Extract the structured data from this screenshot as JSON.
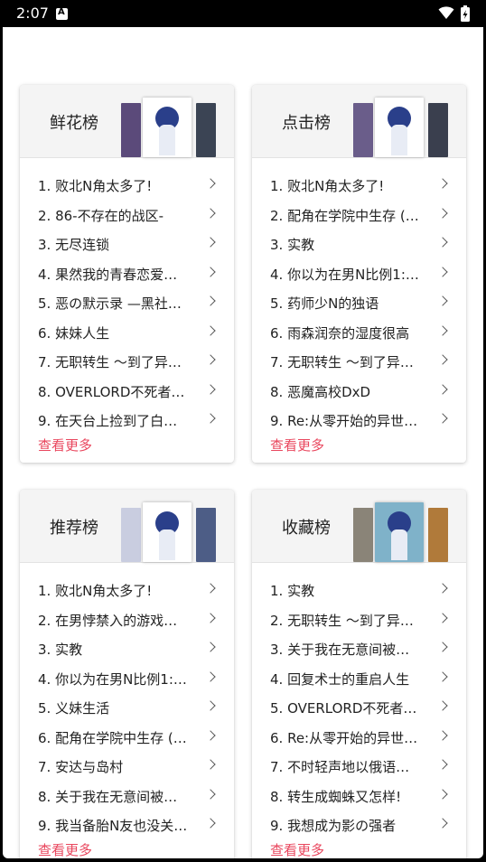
{
  "status_bar": {
    "time": "2:07"
  },
  "boards": [
    {
      "title": "鲜花榜",
      "covers": [
        "#5b4a7a",
        "#ffffff",
        "#3b4454"
      ],
      "items": [
        "1. 败北N角太多了!",
        "2. 86-不存在的战区-",
        "3. 无尽连锁",
        "4. 果然我的青春恋爱喜…",
        "5. 恶の默示录 —黑社…",
        "6. 妹妹人生",
        "7. 无职转生 ～到了异…",
        "8. OVERLORD不死者の…",
        "9. 在天台上捡到了白长…"
      ],
      "more": "查看更多"
    },
    {
      "title": "点击榜",
      "covers": [
        "#6a5d8a",
        "#ffffff",
        "#3a3f4e"
      ],
      "items": [
        "1. 败北N角太多了!",
        "2. 配角在学院中生存 (…",
        "3. 实教",
        "4. 你以为在男N比例1:5…",
        "5. 药师少N的独语",
        "6. 雨森润奈的湿度很高",
        "7. 无职转生 ～到了异…",
        "8. 恶魔高校DxD",
        "9. Re:从零开始的异世…"
      ],
      "more": "查看更多"
    },
    {
      "title": "推荐榜",
      "covers": [
        "#c9cde0",
        "#ffffff",
        "#4d5d86"
      ],
      "items": [
        "1. 败北N角太多了!",
        "2. 在男悖禁入的游戏世…",
        "3. 实教",
        "4. 你以为在男N比例1:5…",
        "5. 义妹生活",
        "6. 配角在学院中生存 (…",
        "7. 安达与岛村",
        "8. 关于我在无意间被隔…",
        "9. 我当备胎N友也没关…"
      ],
      "more": "查看更多"
    },
    {
      "title": "收藏榜",
      "covers": [
        "#8a8478",
        "#7fb2c9",
        "#b07a3a"
      ],
      "items": [
        "1. 实教",
        "2. 无职转生 ～到了异…",
        "3. 关于我在无意间被隔…",
        "4. 回复术士的重启人生",
        "5. OVERLORD不死者の…",
        "6. Re:从零开始的异世…",
        "7. 不时轻声地以俄语遮…",
        "8. 转生成蜘蛛又怎样!",
        "9. 我想成为影の强者"
      ],
      "more": "查看更多"
    }
  ]
}
